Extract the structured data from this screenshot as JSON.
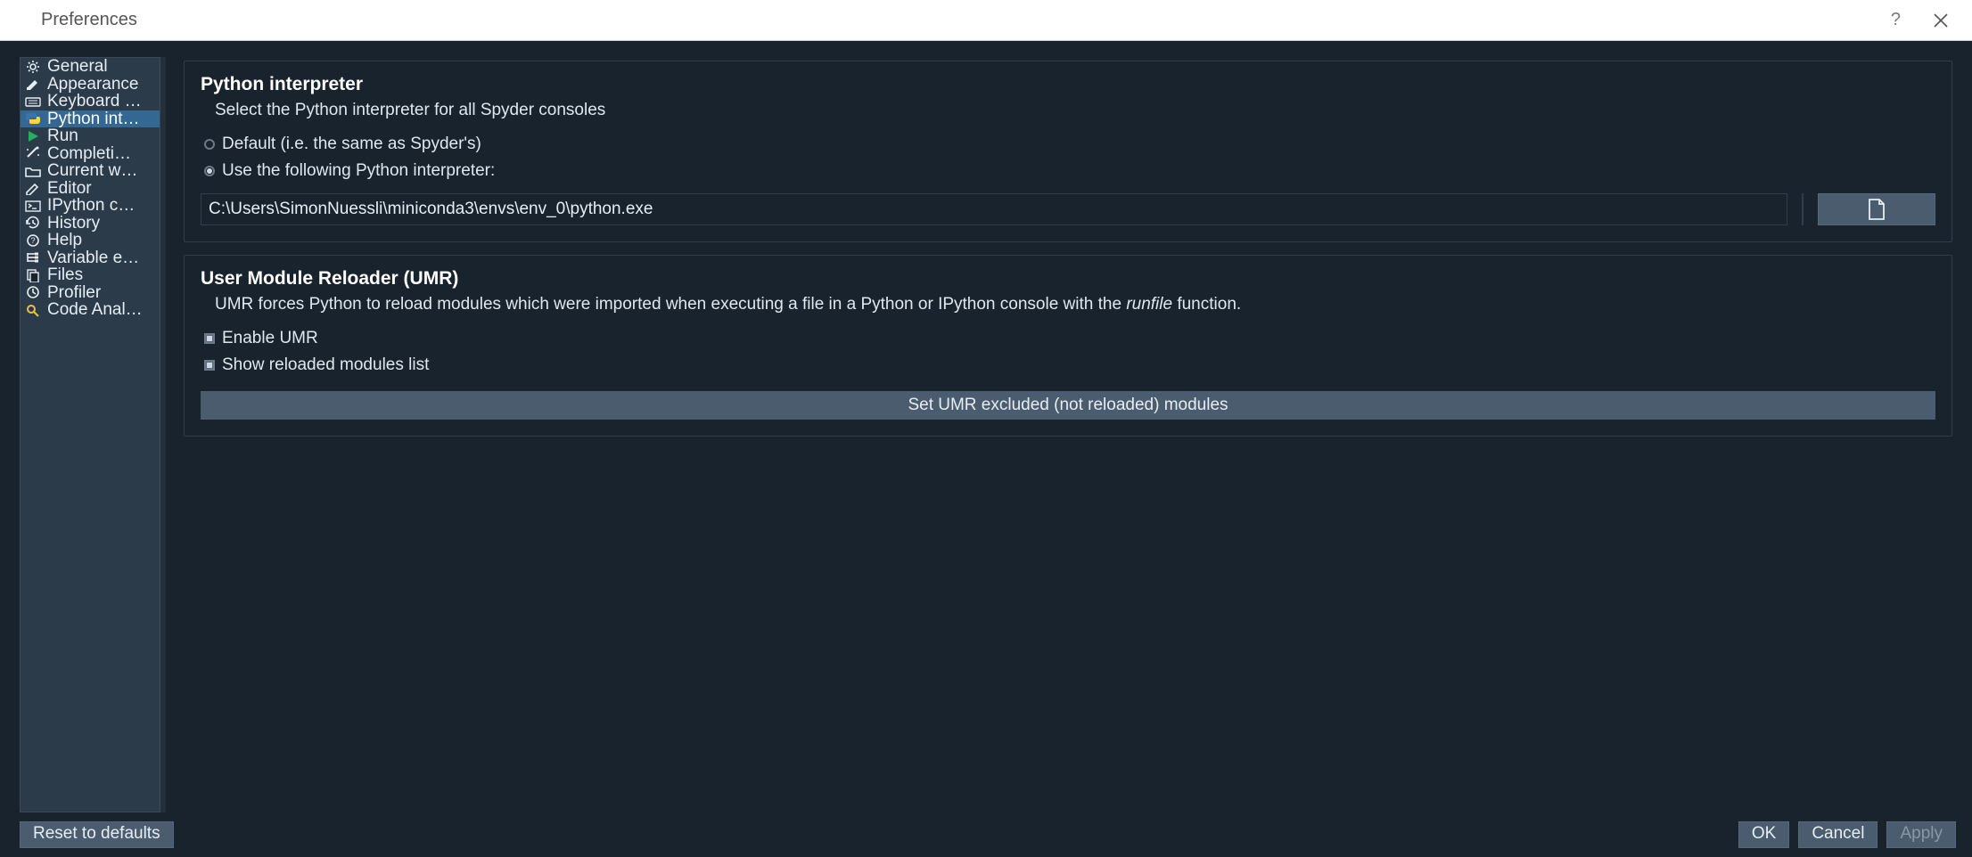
{
  "window": {
    "title": "Preferences"
  },
  "sidebar": {
    "items": [
      {
        "icon": "gear",
        "label": "General"
      },
      {
        "icon": "brush",
        "label": "Appearance"
      },
      {
        "icon": "keyboard",
        "label": "Keyboard …"
      },
      {
        "icon": "python",
        "label": "Python int…"
      },
      {
        "icon": "play",
        "label": "Run"
      },
      {
        "icon": "wand",
        "label": "Completi…"
      },
      {
        "icon": "folder",
        "label": "Current w…"
      },
      {
        "icon": "pencil",
        "label": "Editor"
      },
      {
        "icon": "terminal",
        "label": "IPython c…"
      },
      {
        "icon": "history",
        "label": "History"
      },
      {
        "icon": "help",
        "label": "Help"
      },
      {
        "icon": "tree",
        "label": "Variable e…"
      },
      {
        "icon": "files",
        "label": "Files"
      },
      {
        "icon": "clock",
        "label": "Profiler"
      },
      {
        "icon": "search",
        "label": "Code Anal…"
      }
    ],
    "selected_index": 3
  },
  "interpreter": {
    "title": "Python interpreter",
    "description": "Select the Python interpreter for all Spyder consoles",
    "option_default": "Default (i.e. the same as Spyder's)",
    "option_custom": "Use the following Python interpreter:",
    "selected": "custom",
    "path_value": "C:\\Users\\SimonNuessli\\miniconda3\\envs\\env_0\\python.exe"
  },
  "umr": {
    "title": "User Module Reloader (UMR)",
    "description_pre": "UMR forces Python to reload modules which were imported when executing a file in a Python or IPython console with the ",
    "description_em": "runfile",
    "description_post": " function.",
    "enable_label": "Enable UMR",
    "show_label": "Show reloaded modules list",
    "enable_checked": true,
    "show_checked": true,
    "excluded_button": "Set UMR excluded (not reloaded) modules"
  },
  "buttons": {
    "reset": "Reset to defaults",
    "ok": "OK",
    "cancel": "Cancel",
    "apply": "Apply"
  }
}
